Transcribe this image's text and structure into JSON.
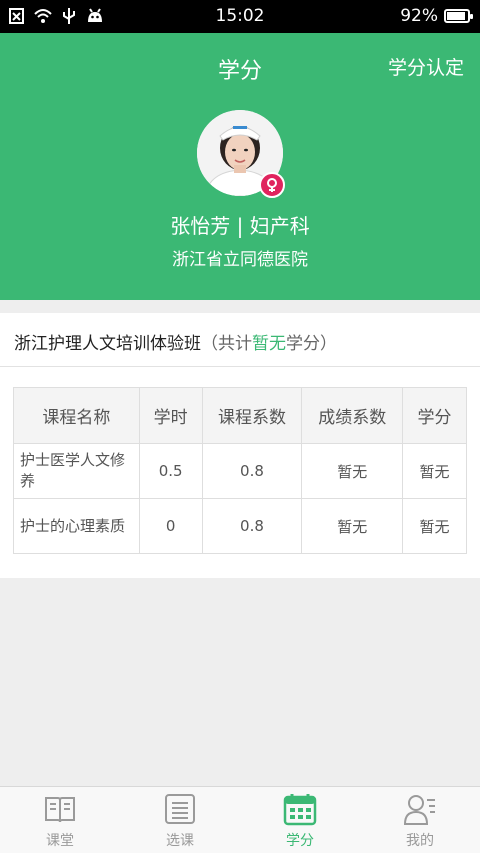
{
  "status_bar": {
    "time": "15:02",
    "battery": "92%",
    "battery_level": 0.92,
    "icons": [
      "notification-x-icon",
      "wifi-icon",
      "usb-icon",
      "android-icon"
    ]
  },
  "header": {
    "title": "学分",
    "action": "学分认定",
    "user_name": "张怡芳 | 妇产科",
    "hospital": "浙江省立同德医院",
    "accent_color": "#3bb874",
    "badge_color": "#e0245e",
    "badge_icon": "female-icon"
  },
  "class_info": {
    "name": "浙江护理人文培训体验班",
    "total_prefix": "（共计",
    "total_value": "暂无",
    "total_suffix": "学分）"
  },
  "table": {
    "columns": [
      "课程名称",
      "学时",
      "课程系数",
      "成绩系数",
      "学分"
    ],
    "rows": [
      [
        "护士医学人文修养",
        "0.5",
        "0.8",
        "暂无",
        "暂无"
      ],
      [
        "护士的心理素质",
        "0",
        "0.8",
        "暂无",
        "暂无"
      ]
    ]
  },
  "tabbar": {
    "items": [
      {
        "label": "课堂",
        "icon": "book-icon"
      },
      {
        "label": "选课",
        "icon": "list-icon"
      },
      {
        "label": "学分",
        "icon": "calendar-icon",
        "active": true
      },
      {
        "label": "我的",
        "icon": "user-icon"
      }
    ]
  }
}
